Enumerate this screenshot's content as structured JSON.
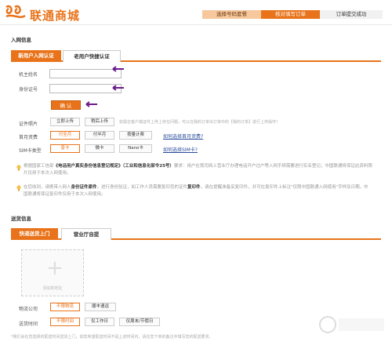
{
  "header": {
    "logo_text": "联通商城",
    "steps": [
      "选择号码套餐",
      "核对填写订单",
      "订单提交成功"
    ]
  },
  "network": {
    "title": "入网信息",
    "tabs": [
      "新用户入网认证",
      "老用户快捷认证"
    ],
    "name_label": "机主姓名",
    "id_label": "身份证号",
    "submit_label": "确 认",
    "photo_label": "证件照片",
    "photo_buttons": [
      "立即上传",
      "稍后上传"
    ],
    "photo_hint": "如需在客户端证件上传上存在问题，可以在我的订单出订单中的【我的订单】进行上传操作！",
    "first_month_label": "首月资费",
    "first_month_options": [
      "付全月",
      "付半月",
      "按量计费"
    ],
    "first_month_link": "如何选择首月资费?",
    "sim_label": "SIM卡类型",
    "sim_options": [
      "普卡",
      "微卡",
      "Nano卡"
    ],
    "sim_link": "如何选择SIM卡?",
    "notice1_pre": "根据国家工信部",
    "notice1_hl": "《电话用户真实身份信息登记规定》（工业和信息化部令25号）",
    "notice1_post": "要求：用户在我司网上营业厅办理电话开户过户等入网手续需要进行实名登记；中国联通将保证此资料照片仅用于本次入网使用。",
    "notice2_pre": "在您收到，请携带入网人",
    "notice2_hl": "身份证件原件",
    "notice2_mid": "，进行身份验证，如工作人员需要复印您的证件",
    "notice2_hl2": "复印件",
    "notice2_post": "，请在提醒准备妥复印件，并可在复印件上标注\"仅限中国联通入网使用\"字样及日期。中国联通将保证复印件仅用于本次入网使用。"
  },
  "delivery": {
    "title": "送货信息",
    "tabs": [
      "快递送货上门",
      "营业厅自提"
    ],
    "add_caption": "添加新地址",
    "company_label": "物流公司",
    "company_options": [
      "不限物流",
      "顺丰速运"
    ],
    "time_label": "送货时间",
    "time_options": [
      "不限时间",
      "仅工作日",
      "仅周末/节假日"
    ],
    "bottom_note": "*我们会在您选择的配送时间送货上门，如您希望配送时间不是上述时间内，请在您下单的备注中填写您的配送要求。"
  },
  "colors": {
    "accent": "#e8731a",
    "link": "#2a4b9a",
    "arrow": "#6a1b8a"
  }
}
